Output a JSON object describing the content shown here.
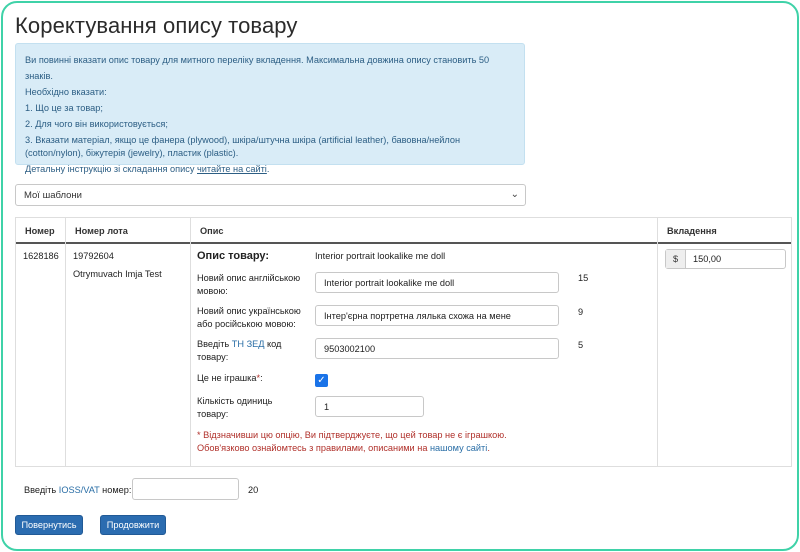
{
  "page_title": "Коректування опису товару",
  "info": {
    "line1": "Ви повинні вказати опис товару для митного переліку вкладення. Максимальна довжина опису становить 50 знаків.",
    "line2": "Необхідно вказати:",
    "line3": "1. Що це за товар;",
    "line4": "2. Для чого він використовується;",
    "line5": "3. Вказати матеріал, якщо це фанера (plywood), шкіра/штучна шкіра (artificial leather), бавовна/нейлон (cotton/nylon), біжутерія (jewelry), пластик (plastic).",
    "line6_prefix": "Детальну інструкцію зі складання опису ",
    "line6_link": "читайте на сайті",
    "line6_suffix": "."
  },
  "templates_select": {
    "selected": "Мої шаблони"
  },
  "table": {
    "headers": {
      "number": "Номер",
      "lot": "Номер лота",
      "description": "Опис",
      "attachment": "Вкладення"
    },
    "row": {
      "number": "1628186",
      "lot": "19792604",
      "recipient": "Otrymuvach Imja Test",
      "desc_heading": "Опис товару:",
      "desc_current": "Interior portrait lookalike me doll",
      "en_label": "Новий опис англійською мовою:",
      "en_value": "Interior portrait lookalike me doll",
      "en_count": "15",
      "ua_label": "Новий опис українською або російською мовою:",
      "ua_value": "Інтер'єрна портретна лялька схожа на мене",
      "ua_count": "9",
      "code_label_prefix": "Введіть ",
      "code_label_link": "ТН ЗЕД",
      "code_label_suffix": " код товару:",
      "code_value": "9503002100",
      "code_count": "5",
      "toy_label": "Це не іграшка",
      "toy_required": "*",
      "toy_colon": ":",
      "toy_checked": true,
      "qty_label": "Кількість одиниць товару:",
      "qty_value": "1",
      "note_line1": "* Відзначивши цю опцію, Ви підтверджуєте, що цей товар не є іграшкою.",
      "note_line2_prefix": "Обов'язково ознайомтесь з правилами, описаними на ",
      "note_line2_link": "нашому сайті",
      "note_line2_suffix": ".",
      "currency": "$",
      "amount": "150,00"
    }
  },
  "ioss": {
    "label_prefix": "Введіть ",
    "label_link": "IOSS/VAT",
    "label_suffix": " номер:",
    "value": "",
    "count": "20"
  },
  "buttons": {
    "back": "Повернутись",
    "continue": "Продовжити"
  },
  "colors": {
    "accent": "#2b6cb0",
    "info_bg": "#d9ecf7",
    "frame": "#3fd2a8",
    "warning_text": "#b0302a",
    "link": "#2a6ea6"
  }
}
